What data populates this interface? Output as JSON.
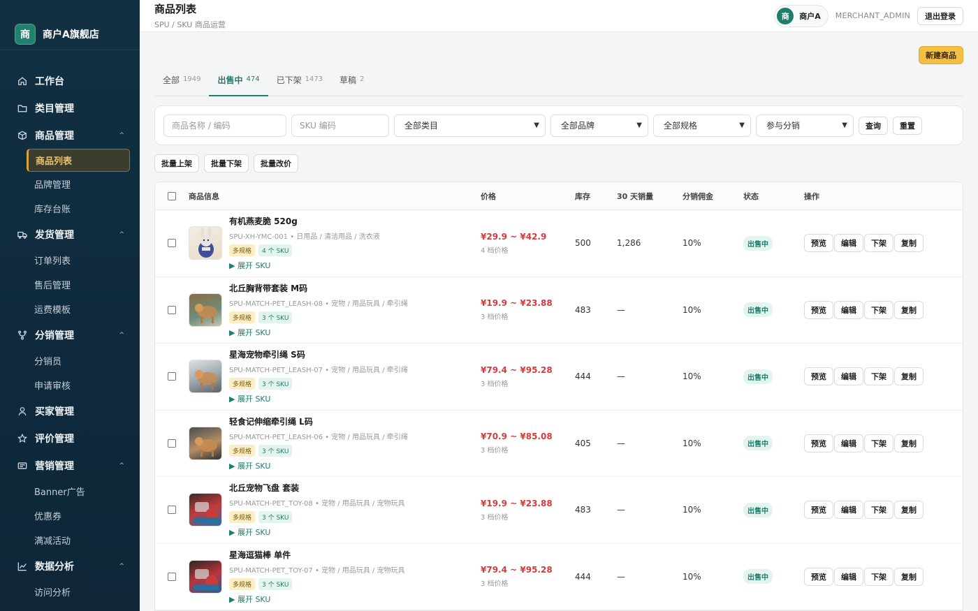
{
  "brand": {
    "logo_char": "商",
    "name": "商户A旗舰店"
  },
  "nav": [
    {
      "type": "group",
      "label": "工作台",
      "icon": "home-icon",
      "expandable": false
    },
    {
      "type": "group",
      "label": "类目管理",
      "icon": "folder-icon",
      "expandable": false
    },
    {
      "type": "group",
      "label": "商品管理",
      "icon": "box-icon",
      "expandable": true
    },
    {
      "type": "sub",
      "label": "商品列表",
      "active": true
    },
    {
      "type": "sub",
      "label": "品牌管理"
    },
    {
      "type": "sub",
      "label": "库存台账"
    },
    {
      "type": "group",
      "label": "发货管理",
      "icon": "truck-icon",
      "expandable": true
    },
    {
      "type": "sub",
      "label": "订单列表"
    },
    {
      "type": "sub",
      "label": "售后管理"
    },
    {
      "type": "sub",
      "label": "运费模板"
    },
    {
      "type": "group",
      "label": "分销管理",
      "icon": "share-icon",
      "expandable": true
    },
    {
      "type": "sub",
      "label": "分销员"
    },
    {
      "type": "sub",
      "label": "申请审核"
    },
    {
      "type": "group",
      "label": "买家管理",
      "icon": "user-icon",
      "expandable": false
    },
    {
      "type": "group",
      "label": "评价管理",
      "icon": "star-icon",
      "expandable": false
    },
    {
      "type": "group",
      "label": "营销管理",
      "icon": "ticket-icon",
      "expandable": true
    },
    {
      "type": "sub",
      "label": "Banner广告"
    },
    {
      "type": "sub",
      "label": "优惠券"
    },
    {
      "type": "sub",
      "label": "满减活动"
    },
    {
      "type": "group",
      "label": "数据分析",
      "icon": "chart-icon",
      "expandable": true
    },
    {
      "type": "sub",
      "label": "访问分析"
    }
  ],
  "header": {
    "title": "商品列表",
    "subtitle": "SPU / SKU 商品运营",
    "avatar_char": "商",
    "user_name": "商户A",
    "role": "MERCHANT_ADMIN",
    "logout": "退出登录"
  },
  "new_button": "新建商品",
  "tabs": [
    {
      "label": "全部",
      "count": "1949",
      "active": false
    },
    {
      "label": "出售中",
      "count": "474",
      "active": true
    },
    {
      "label": "已下架",
      "count": "1473",
      "active": false
    },
    {
      "label": "草稿",
      "count": "2",
      "active": false
    }
  ],
  "filters": {
    "name_placeholder": "商品名称 / 编码",
    "sku_placeholder": "SKU 编码",
    "category": "全部类目",
    "brand": "全部品牌",
    "spec": "全部规格",
    "distribution": "参与分销",
    "query": "查询",
    "reset": "重置"
  },
  "batch": [
    "批量上架",
    "批量下架",
    "批量改价"
  ],
  "columns": {
    "info": "商品信息",
    "price": "价格",
    "stock": "库存",
    "sales": "30 天销量",
    "commission": "分销佣金",
    "status": "状态",
    "ops": "操作"
  },
  "ops_labels": {
    "preview": "预览",
    "edit": "编辑",
    "off": "下架",
    "copy": "复制"
  },
  "expand_label": "▶ 展开 SKU",
  "products": [
    {
      "name": "有机燕麦脆 520g",
      "code": "SPU-XH-YMC-001",
      "category": "日用品 / 清洁用品 / 洗衣液",
      "tag1": "多规格",
      "tag2": "4 个 SKU",
      "price": "¥29.9 ~ ¥42.9",
      "tiers": "4 档价格",
      "stock": "500",
      "sales": "1,286",
      "commission": "10%",
      "status": "出售中",
      "thumb": "rabbit-plush"
    },
    {
      "name": "北丘胸背带套装 M码",
      "code": "SPU-MATCH-PET_LEASH-08",
      "category": "宠物 / 用品玩具 / 牵引绳",
      "tag1": "多规格",
      "tag2": "3 个 SKU",
      "price": "¥19.9 ~ ¥23.88",
      "tiers": "3 档价格",
      "stock": "483",
      "sales": "—",
      "commission": "10%",
      "status": "出售中",
      "thumb": "dog-photo"
    },
    {
      "name": "星海宠物牵引绳 S码",
      "code": "SPU-MATCH-PET_LEASH-07",
      "category": "宠物 / 用品玩具 / 牵引绳",
      "tag1": "多规格",
      "tag2": "3 个 SKU",
      "price": "¥79.4 ~ ¥95.28",
      "tiers": "3 档价格",
      "stock": "444",
      "sales": "—",
      "commission": "10%",
      "status": "出售中",
      "thumb": "dog-photo"
    },
    {
      "name": "轻食记伸缩牵引绳 L码",
      "code": "SPU-MATCH-PET_LEASH-06",
      "category": "宠物 / 用品玩具 / 牵引绳",
      "tag1": "多规格",
      "tag2": "3 个 SKU",
      "price": "¥70.9 ~ ¥85.08",
      "tiers": "3 档价格",
      "stock": "405",
      "sales": "—",
      "commission": "10%",
      "status": "出售中",
      "thumb": "dog-photo"
    },
    {
      "name": "北丘宠物飞盘 套装",
      "code": "SPU-MATCH-PET_TOY-08",
      "category": "宠物 / 用品玩具 / 宠物玩具",
      "tag1": "多规格",
      "tag2": "3 个 SKU",
      "price": "¥19.9 ~ ¥23.88",
      "tiers": "3 档价格",
      "stock": "483",
      "sales": "—",
      "commission": "10%",
      "status": "出售中",
      "thumb": "toy-photo"
    },
    {
      "name": "星海逗猫棒 单件",
      "code": "SPU-MATCH-PET_TOY-07",
      "category": "宠物 / 用品玩具 / 宠物玩具",
      "tag1": "多规格",
      "tag2": "3 个 SKU",
      "price": "¥79.4 ~ ¥95.28",
      "tiers": "3 档价格",
      "stock": "444",
      "sales": "—",
      "commission": "10%",
      "status": "出售中",
      "thumb": "toy-photo"
    }
  ]
}
